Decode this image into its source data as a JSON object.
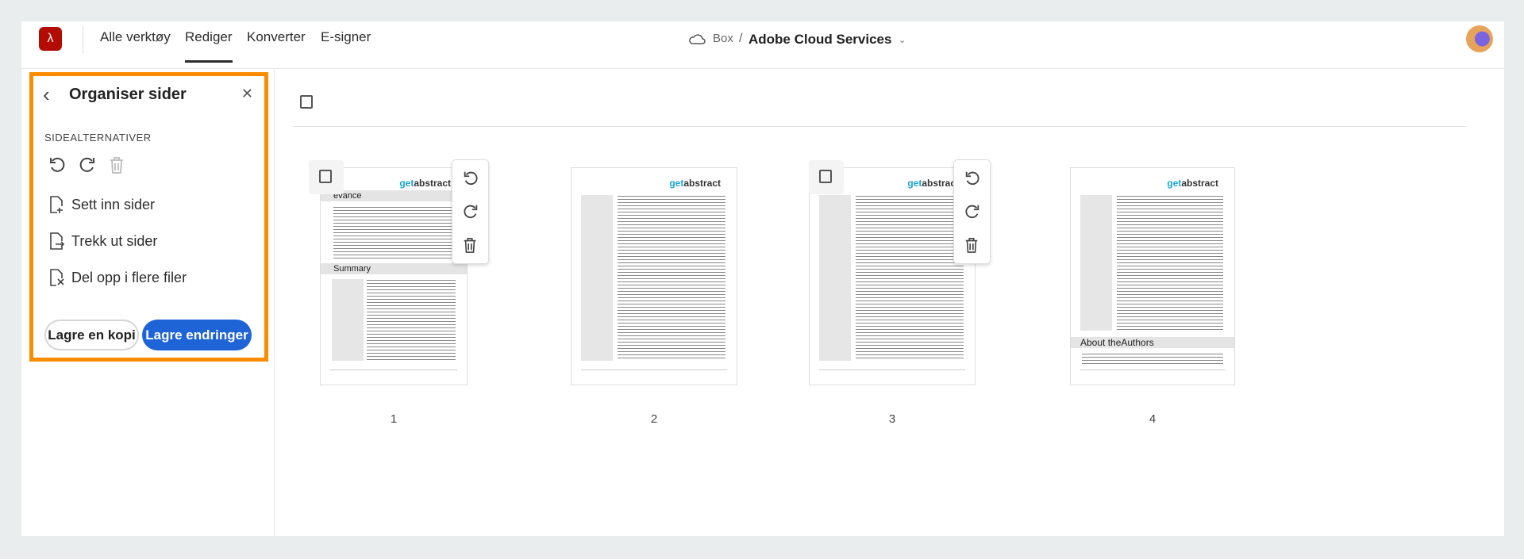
{
  "header": {
    "tabs": [
      {
        "label": "Alle verktøy"
      },
      {
        "label": "Rediger",
        "active": true
      },
      {
        "label": "Konverter"
      },
      {
        "label": "E-signer"
      }
    ],
    "breadcrumb": {
      "root": "Box",
      "separator": "/",
      "current": "Adobe Cloud Services"
    }
  },
  "panel": {
    "title": "Organiser sider",
    "section": "SIDEALTERNATIVER",
    "icons": [
      "rotate-left-icon",
      "rotate-right-icon",
      "trash-icon"
    ],
    "items": [
      {
        "label": "Sett inn sider",
        "icon": "insert-page-icon"
      },
      {
        "label": "Trekk ut sider",
        "icon": "extract-page-icon"
      },
      {
        "label": "Del opp i flere filer",
        "icon": "split-file-icon"
      }
    ],
    "save_copy": "Lagre en kopi",
    "save_changes": "Lagre endringer"
  },
  "pages": [
    {
      "number": "1",
      "brand_a": "get",
      "brand_b": "abstract",
      "heading1": "evance",
      "heading2": "Summary"
    },
    {
      "number": "2",
      "brand_a": "get",
      "brand_b": "abstract"
    },
    {
      "number": "3",
      "brand_a": "get",
      "brand_b": "abstract"
    },
    {
      "number": "4",
      "brand_a": "get",
      "brand_b": "abstract",
      "heading3": "About theAuthors"
    }
  ],
  "colors": {
    "accent": "#1f64d6",
    "highlight": "#fb8c00",
    "logo": "#b30b00"
  }
}
